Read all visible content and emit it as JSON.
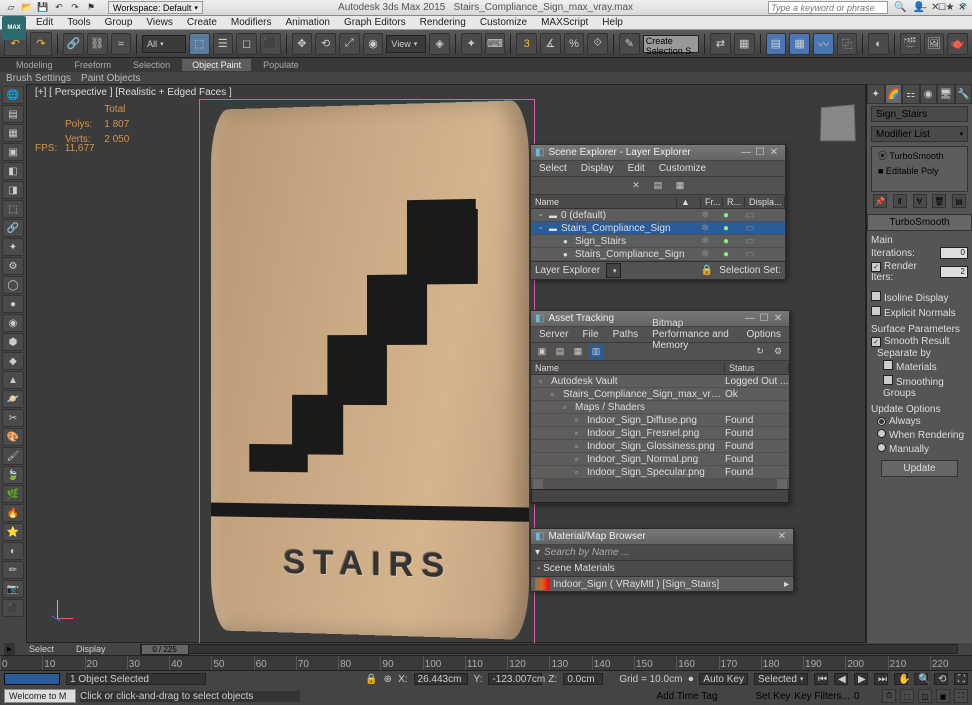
{
  "titlebar": {
    "workspace": "Workspace: Default",
    "appname": "Autodesk 3ds Max  2015",
    "filename": "Stairs_Compliance_Sign_max_vray.max",
    "searchPlaceholder": "Type a keyword or phrase"
  },
  "menubar": [
    "Edit",
    "Tools",
    "Group",
    "Views",
    "Create",
    "Modifiers",
    "Animation",
    "Graph Editors",
    "Rendering",
    "Customize",
    "MAXScript",
    "Help"
  ],
  "toolbar": {
    "selFilter": "All",
    "viewCombo": "View",
    "createSel": "Create Selection S"
  },
  "ribbon": {
    "tabs": [
      "Modeling",
      "Freeform",
      "Selection",
      "Object Paint",
      "Populate"
    ],
    "active": 3
  },
  "brushbar": [
    "Brush Settings",
    "Paint Objects"
  ],
  "viewport": {
    "label": "[+] [ Perspective ] [Realistic + Edged Faces ]",
    "stats": {
      "polysLabel": "Polys:",
      "polys": "1 807",
      "vertsLabel": "Verts:",
      "verts": "2 050",
      "totalLabel": "Total"
    },
    "fpsLabel": "FPS:",
    "fps": "11,677",
    "signText": "STAIRS"
  },
  "sceneExplorer": {
    "title": "Scene Explorer - Layer Explorer",
    "menus": [
      "Select",
      "Display",
      "Edit",
      "Customize"
    ],
    "cols": {
      "name": "Name",
      "frozen": "Fr...",
      "render": "R...",
      "display": "Displa..."
    },
    "rows": [
      {
        "indent": 0,
        "name": "0 (default)",
        "sel": false,
        "exp": "-"
      },
      {
        "indent": 0,
        "name": "Stairs_Compliance_Sign",
        "sel": true,
        "exp": "-"
      },
      {
        "indent": 1,
        "name": "Sign_Stairs",
        "sel": false,
        "exp": ""
      },
      {
        "indent": 1,
        "name": "Stairs_Compliance_Sign",
        "sel": false,
        "exp": ""
      }
    ],
    "footerLabel": "Layer Explorer",
    "selSet": "Selection Set:"
  },
  "assetTracking": {
    "title": "Asset Tracking",
    "menus": [
      "Server",
      "File",
      "Paths",
      "Bitmap Performance and Memory",
      "Options"
    ],
    "cols": {
      "name": "Name",
      "status": "Status"
    },
    "rows": [
      {
        "indent": 0,
        "name": "Autodesk Vault",
        "status": "Logged Out ..."
      },
      {
        "indent": 1,
        "name": "Stairs_Compliance_Sign_max_vray.max",
        "status": "Ok"
      },
      {
        "indent": 2,
        "name": "Maps / Shaders",
        "status": ""
      },
      {
        "indent": 3,
        "name": "Indoor_Sign_Diffuse.png",
        "status": "Found"
      },
      {
        "indent": 3,
        "name": "Indoor_Sign_Fresnel.png",
        "status": "Found"
      },
      {
        "indent": 3,
        "name": "Indoor_Sign_Glossiness.png",
        "status": "Found"
      },
      {
        "indent": 3,
        "name": "Indoor_Sign_Normal.png",
        "status": "Found"
      },
      {
        "indent": 3,
        "name": "Indoor_Sign_Specular.png",
        "status": "Found"
      }
    ]
  },
  "matBrowser": {
    "title": "Material/Map Browser",
    "searchPlaceholder": "Search by Name ...",
    "sectionLabel": "Scene Materials",
    "mat": "Indoor_Sign ( VRayMtl ) [Sign_Stairs]"
  },
  "cmdPanel": {
    "objName": "Sign_Stairs",
    "modList": "Modifier List",
    "stack": [
      "TurboSmooth",
      "Editable Poly"
    ],
    "rollout": "TurboSmooth",
    "main": "Main",
    "iterLabel": "Iterations:",
    "iter": "0",
    "renderIterLabel": "Render Iters:",
    "renderIter": "2",
    "renderIterOn": true,
    "isoline": "Isoline Display",
    "explicit": "Explicit Normals",
    "surfParams": "Surface Parameters",
    "smoothResult": "Smooth Result",
    "smoothResultOn": true,
    "separate": "Separate by",
    "materials": "Materials",
    "smoothGroups": "Smoothing Groups",
    "updateOpts": "Update Options",
    "always": "Always",
    "whenRender": "When Rendering",
    "manually": "Manually",
    "updateSel": "always",
    "updateBtn": "Update"
  },
  "slider": {
    "select": "Select",
    "display": "Display",
    "frame": "0 / 225"
  },
  "timeline": {
    "ticks": [
      "0",
      "10",
      "20",
      "30",
      "40",
      "50",
      "60",
      "70",
      "80",
      "90",
      "100",
      "110",
      "120",
      "130",
      "140",
      "150",
      "160",
      "170",
      "180",
      "190",
      "200",
      "210",
      "220"
    ]
  },
  "status": {
    "objSel": "1 Object Selected",
    "x": "26.443cm",
    "y": "-123.007cm",
    "z": "0.0cm",
    "grid": "Grid = 10.0cm",
    "autoKey": "Auto Key",
    "selected": "Selected",
    "setKey": "Set Key",
    "keyFilters": "Key Filters...",
    "welcome": "Welcome to M",
    "prompt": "Click or click-and-drag to select objects",
    "addTimeTag": "Add Time Tag"
  }
}
